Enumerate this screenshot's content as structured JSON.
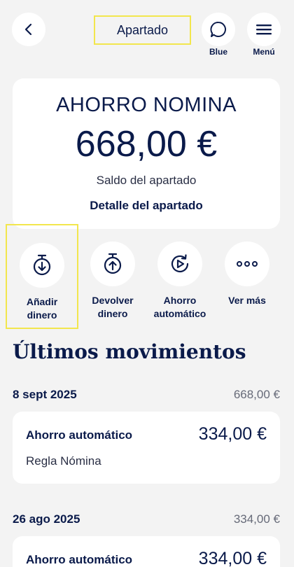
{
  "header": {
    "title": "Apartado",
    "blue_label": "Blue",
    "menu_label": "Menú"
  },
  "balance": {
    "name": "AHORRO NOMINA",
    "amount": "668,00 €",
    "caption": "Saldo del apartado",
    "detail_link": "Detalle del apartado"
  },
  "actions": [
    {
      "label": "Añadir\ndinero",
      "icon": "stopwatch-down-icon"
    },
    {
      "label": "Devolver\ndinero",
      "icon": "stopwatch-up-icon"
    },
    {
      "label": "Ahorro\nautomático",
      "icon": "auto-play-icon"
    },
    {
      "label": "Ver más",
      "icon": "more-dots-icon"
    }
  ],
  "movements": {
    "title": "Últimos movimientos",
    "groups": [
      {
        "date": "8 sept 2025",
        "total": "668,00 €",
        "items": [
          {
            "title": "Ahorro automático",
            "amount": "334,00 €",
            "subtitle": "Regla Nómina"
          }
        ]
      },
      {
        "date": "26 ago 2025",
        "total": "334,00 €",
        "items": [
          {
            "title": "Ahorro automático",
            "amount": "334,00 €"
          }
        ]
      }
    ]
  },
  "colors": {
    "background": "#f3f3f3",
    "navy": "#0a1a4a",
    "highlight": "#f2e64d",
    "card": "#ffffff"
  }
}
